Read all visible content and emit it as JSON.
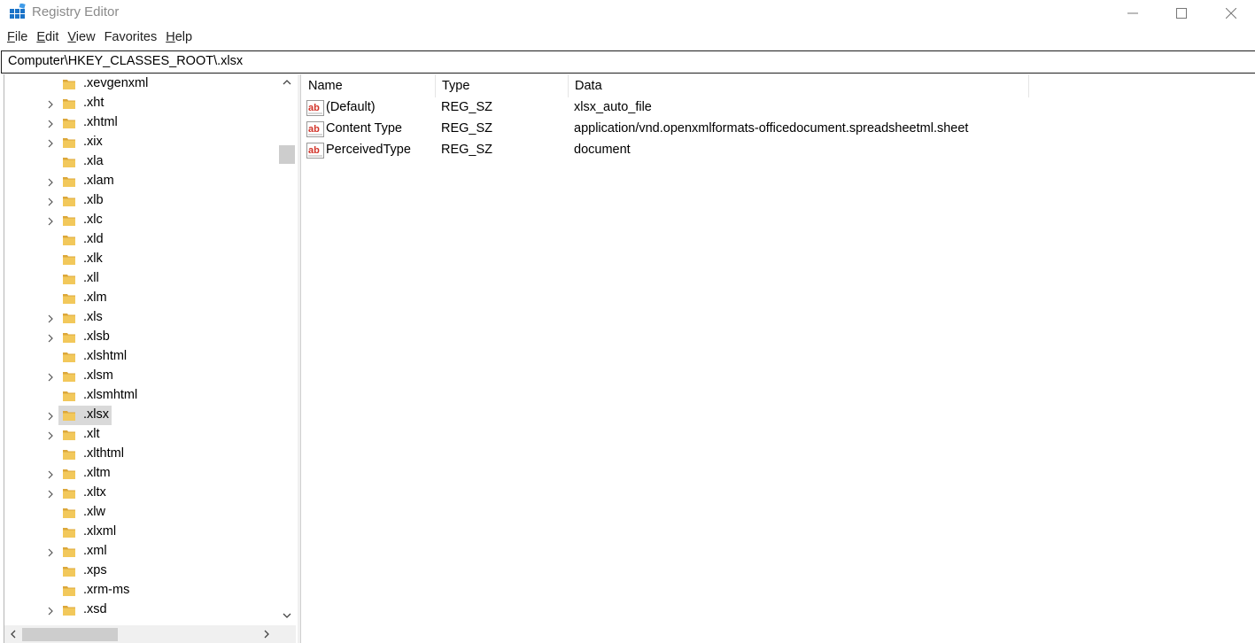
{
  "window": {
    "title": "Registry Editor"
  },
  "menu": [
    {
      "label": "File",
      "accel": "F",
      "rest": "ile"
    },
    {
      "label": "Edit",
      "accel": "E",
      "rest": "dit"
    },
    {
      "label": "View",
      "accel": "V",
      "rest": "iew"
    },
    {
      "label": "Favorites",
      "accel": "",
      "rest": "Favorites"
    },
    {
      "label": "Help",
      "accel": "H",
      "rest": "elp"
    }
  ],
  "address": "Computer\\HKEY_CLASSES_ROOT\\.xlsx",
  "tree": {
    "items": [
      {
        "label": ".xevgenxml",
        "expandable": false,
        "selected": false
      },
      {
        "label": ".xht",
        "expandable": true,
        "selected": false
      },
      {
        "label": ".xhtml",
        "expandable": true,
        "selected": false
      },
      {
        "label": ".xix",
        "expandable": true,
        "selected": false
      },
      {
        "label": ".xla",
        "expandable": false,
        "selected": false
      },
      {
        "label": ".xlam",
        "expandable": true,
        "selected": false
      },
      {
        "label": ".xlb",
        "expandable": true,
        "selected": false
      },
      {
        "label": ".xlc",
        "expandable": true,
        "selected": false
      },
      {
        "label": ".xld",
        "expandable": false,
        "selected": false
      },
      {
        "label": ".xlk",
        "expandable": false,
        "selected": false
      },
      {
        "label": ".xll",
        "expandable": false,
        "selected": false
      },
      {
        "label": ".xlm",
        "expandable": false,
        "selected": false
      },
      {
        "label": ".xls",
        "expandable": true,
        "selected": false
      },
      {
        "label": ".xlsb",
        "expandable": true,
        "selected": false
      },
      {
        "label": ".xlshtml",
        "expandable": false,
        "selected": false
      },
      {
        "label": ".xlsm",
        "expandable": true,
        "selected": false
      },
      {
        "label": ".xlsmhtml",
        "expandable": false,
        "selected": false
      },
      {
        "label": ".xlsx",
        "expandable": true,
        "selected": true
      },
      {
        "label": ".xlt",
        "expandable": true,
        "selected": false
      },
      {
        "label": ".xlthtml",
        "expandable": false,
        "selected": false
      },
      {
        "label": ".xltm",
        "expandable": true,
        "selected": false
      },
      {
        "label": ".xltx",
        "expandable": true,
        "selected": false
      },
      {
        "label": ".xlw",
        "expandable": false,
        "selected": false
      },
      {
        "label": ".xlxml",
        "expandable": false,
        "selected": false
      },
      {
        "label": ".xml",
        "expandable": true,
        "selected": false
      },
      {
        "label": ".xps",
        "expandable": false,
        "selected": false
      },
      {
        "label": ".xrm-ms",
        "expandable": false,
        "selected": false
      },
      {
        "label": ".xsd",
        "expandable": true,
        "selected": false
      }
    ]
  },
  "list": {
    "columns": {
      "name": "Name",
      "type": "Type",
      "data": "Data"
    },
    "rows": [
      {
        "name": "(Default)",
        "type": "REG_SZ",
        "data": "xlsx_auto_file",
        "icon": "string-value-icon"
      },
      {
        "name": "Content Type",
        "type": "REG_SZ",
        "data": "application/vnd.openxmlformats-officedocument.spreadsheetml.sheet",
        "icon": "string-value-icon"
      },
      {
        "name": "PerceivedType",
        "type": "REG_SZ",
        "data": "document",
        "icon": "string-value-icon"
      }
    ]
  },
  "colors": {
    "folder": "#e8b84a",
    "selection": "#d9d9d9",
    "value_icon_red": "#d2342a"
  }
}
